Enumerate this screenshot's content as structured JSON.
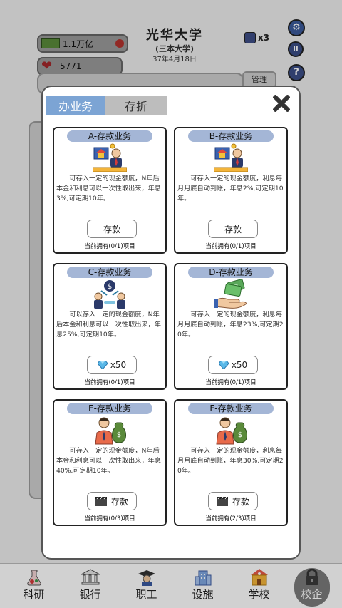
{
  "hud": {
    "money": "1.1万亿",
    "reputation": "5771",
    "university_name": "光华大学",
    "university_tier": "(三本大学)",
    "date": "37年4月18日",
    "speed": "x3",
    "manage_label": "管理"
  },
  "modal": {
    "tabs": [
      {
        "label": "办业务",
        "active": true
      },
      {
        "label": "存折",
        "active": false
      }
    ],
    "cards": [
      {
        "title": "A-存款业务",
        "icon": "bank-teller-icon",
        "desc": "可存入一定的现金额度，N年后本金和利息可以一次性取出来，年息3%,可定期10年。",
        "button": "存款",
        "button_icon": "",
        "owned": "当前拥有(0/1)项目"
      },
      {
        "title": "B-存款业务",
        "icon": "bank-teller-icon",
        "desc": "可存入一定的现金额度，利息每月月底自动到账，年息2%,可定期10年。",
        "button": "存款",
        "button_icon": "",
        "owned": "当前拥有(0/1)项目"
      },
      {
        "title": "C-存款业务",
        "icon": "investors-coin-icon",
        "desc": "可以存入一定的现金额度，N年后本金和利息可以一次性取出来，年息25%,可定期10年。",
        "button": "x50",
        "button_icon": "gem-icon",
        "owned": "当前拥有(0/1)项目"
      },
      {
        "title": "D-存款业务",
        "icon": "money-hand-icon",
        "desc": "可存入一定的现金额度，利息每月月底自动到账，年息23%,可定期20年。",
        "button": "x50",
        "button_icon": "gem-icon",
        "owned": "当前拥有(0/1)项目"
      },
      {
        "title": "E-存款业务",
        "icon": "man-moneybag-icon",
        "desc": "可存入一定的现金额度，N年后本金和利息可以一次性取出来，年息40%,可定期10年。",
        "button": "存款",
        "button_icon": "video-ad-icon",
        "owned": "当前拥有(0/3)项目"
      },
      {
        "title": "F-存款业务",
        "icon": "man-moneybag-icon",
        "desc": "可存入一定的现金额度，利息每月月底自动到账，年息30%,可定期20年。",
        "button": "存款",
        "button_icon": "video-ad-icon",
        "owned": "当前拥有(2/3)项目"
      }
    ]
  },
  "bottom_nav": [
    {
      "label": "科研",
      "icon": "flask-icon"
    },
    {
      "label": "银行",
      "icon": "bank-icon"
    },
    {
      "label": "职工",
      "icon": "graduate-icon"
    },
    {
      "label": "设施",
      "icon": "building-icon"
    },
    {
      "label": "学校",
      "icon": "school-icon"
    },
    {
      "label": "校企",
      "icon": "lock-icon"
    }
  ],
  "colors": {
    "tab_active": "#7ca4d4",
    "tab_inactive": "#bdbdbd",
    "card_title_bg": "#a4b6d6"
  }
}
